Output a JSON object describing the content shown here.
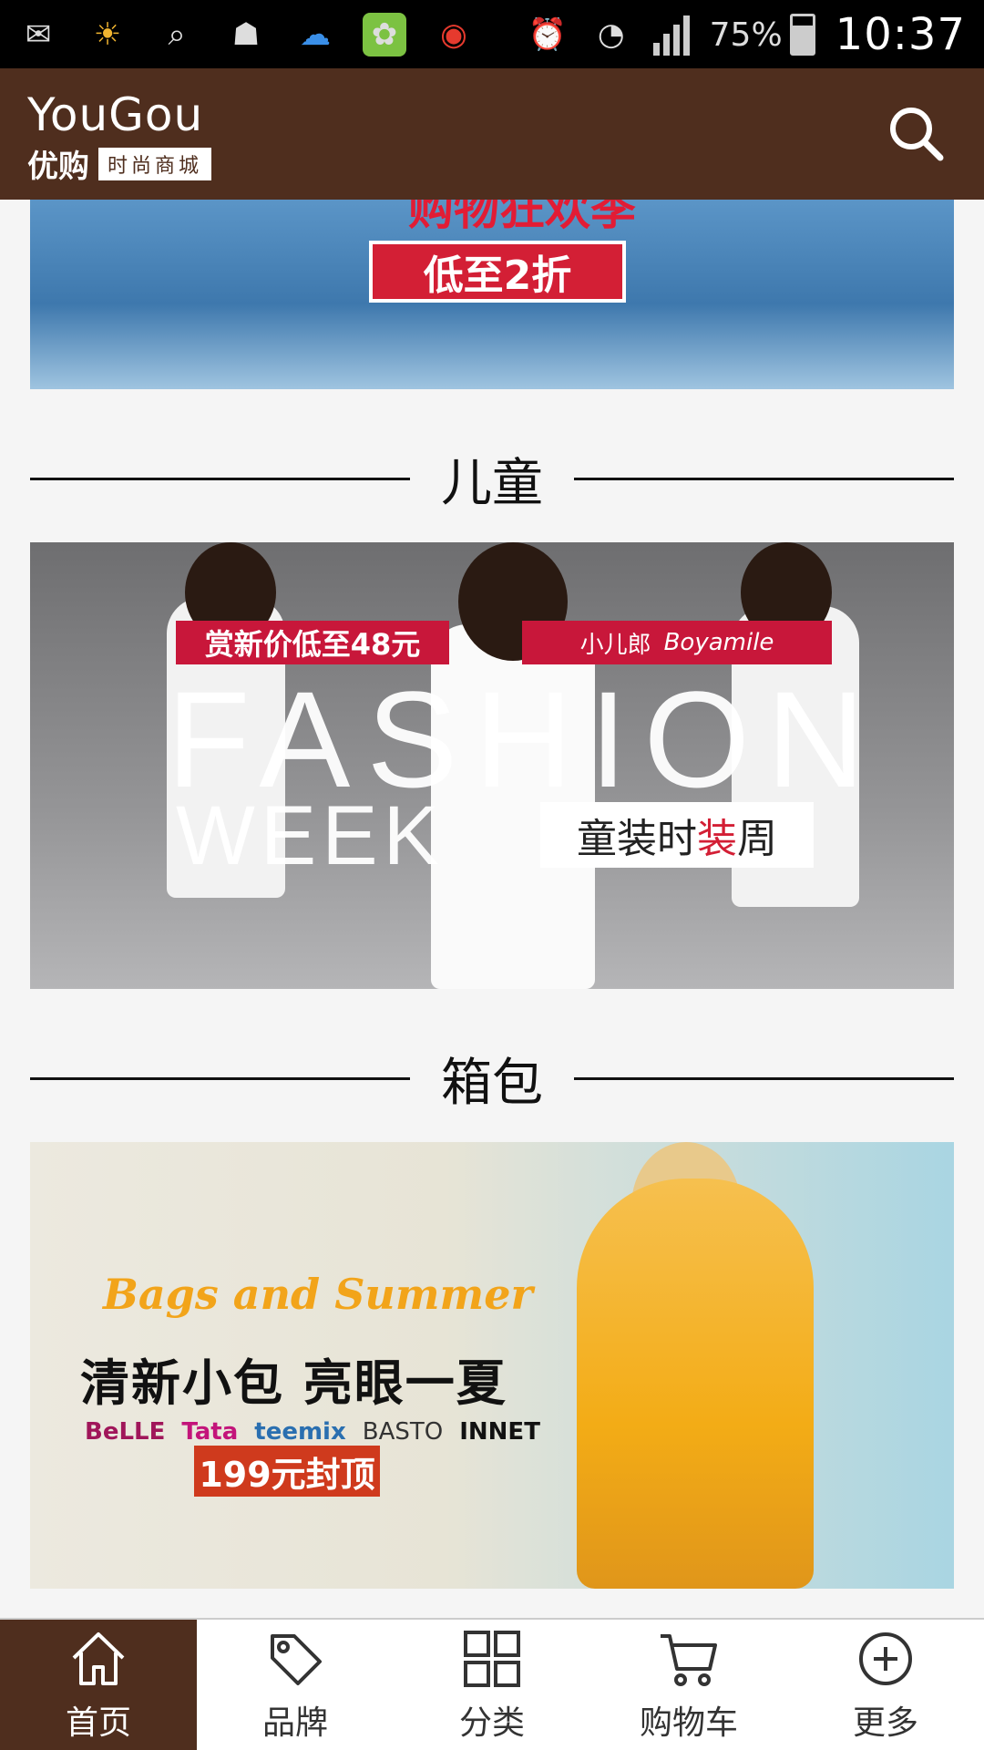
{
  "status_bar": {
    "battery": "75%",
    "time": "10:37"
  },
  "header": {
    "logo_en": "YouGou",
    "logo_cn": "优购",
    "logo_tag": "时尚商城"
  },
  "banners": {
    "top": {
      "tag": "低至2折",
      "headline": "购物狂欢季"
    },
    "kids": {
      "promo": "赏新价低至48元",
      "brand_cn": "小儿郎",
      "brand_en": "Boyamile",
      "fashion": "FASHION",
      "week": "WEEK",
      "cn_prefix": "童装时",
      "cn_red": "装",
      "cn_suffix": "周"
    },
    "bags": {
      "script": "Bags and Summer",
      "cn": "清新小包 亮眼一夏",
      "brands": [
        "BeLLE",
        "Tata",
        "teemix",
        "BASTO",
        "INNET"
      ],
      "price": "199元封顶"
    }
  },
  "sections": {
    "kids_title": "儿童",
    "bags_title": "箱包"
  },
  "bottom_nav": [
    {
      "label": "首页",
      "icon": "home-icon",
      "active": true
    },
    {
      "label": "品牌",
      "icon": "tag-icon",
      "active": false
    },
    {
      "label": "分类",
      "icon": "grid-icon",
      "active": false
    },
    {
      "label": "购物车",
      "icon": "cart-icon",
      "active": false
    },
    {
      "label": "更多",
      "icon": "plus-circle-icon",
      "active": false
    }
  ],
  "colors": {
    "header_bg": "#4f2e1e",
    "page_bg": "#f5f5f5",
    "accent_red": "#d31f35"
  }
}
